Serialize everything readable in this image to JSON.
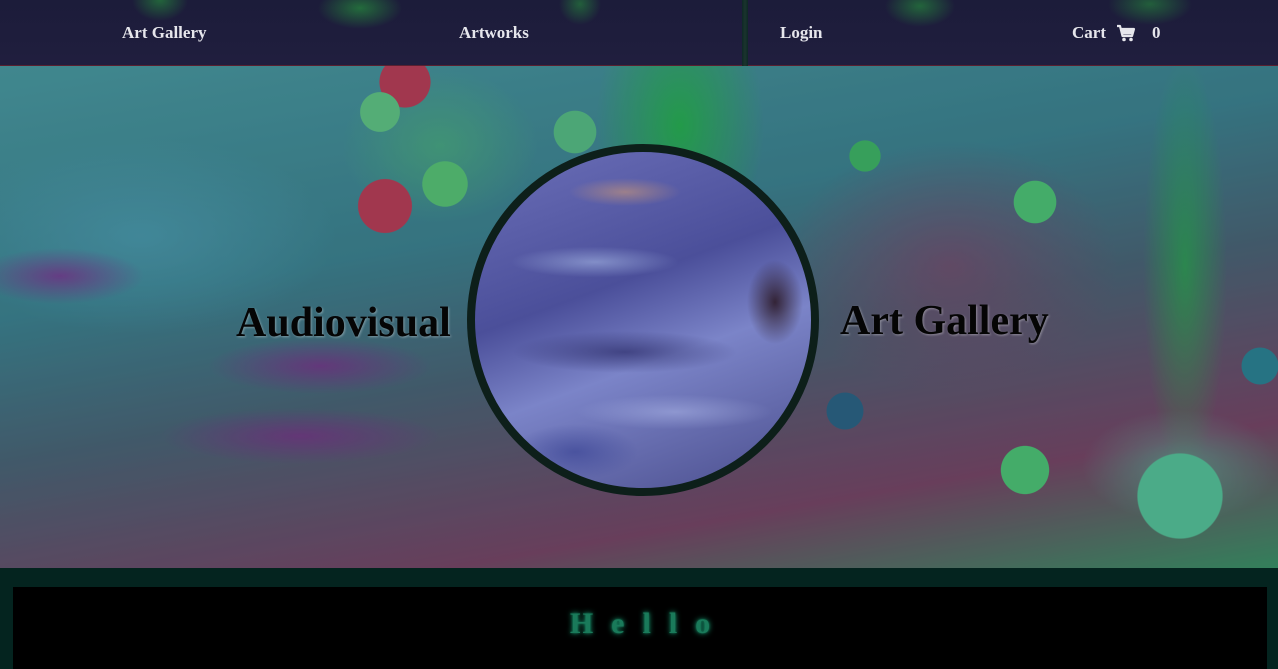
{
  "nav": {
    "brand": "Art Gallery",
    "artworks": "Artworks",
    "login": "Login",
    "cart_label": "Cart",
    "cart_icon": "shopping-cart-icon",
    "cart_count": "0"
  },
  "hero": {
    "left_text": "Audiovisual",
    "right_text": "Art Gallery"
  },
  "section": {
    "greeting": "Hello"
  },
  "colors": {
    "nav_bg": "#1c1c3a",
    "page_bg": "#04241f",
    "greeting": "#1a7a5a"
  }
}
